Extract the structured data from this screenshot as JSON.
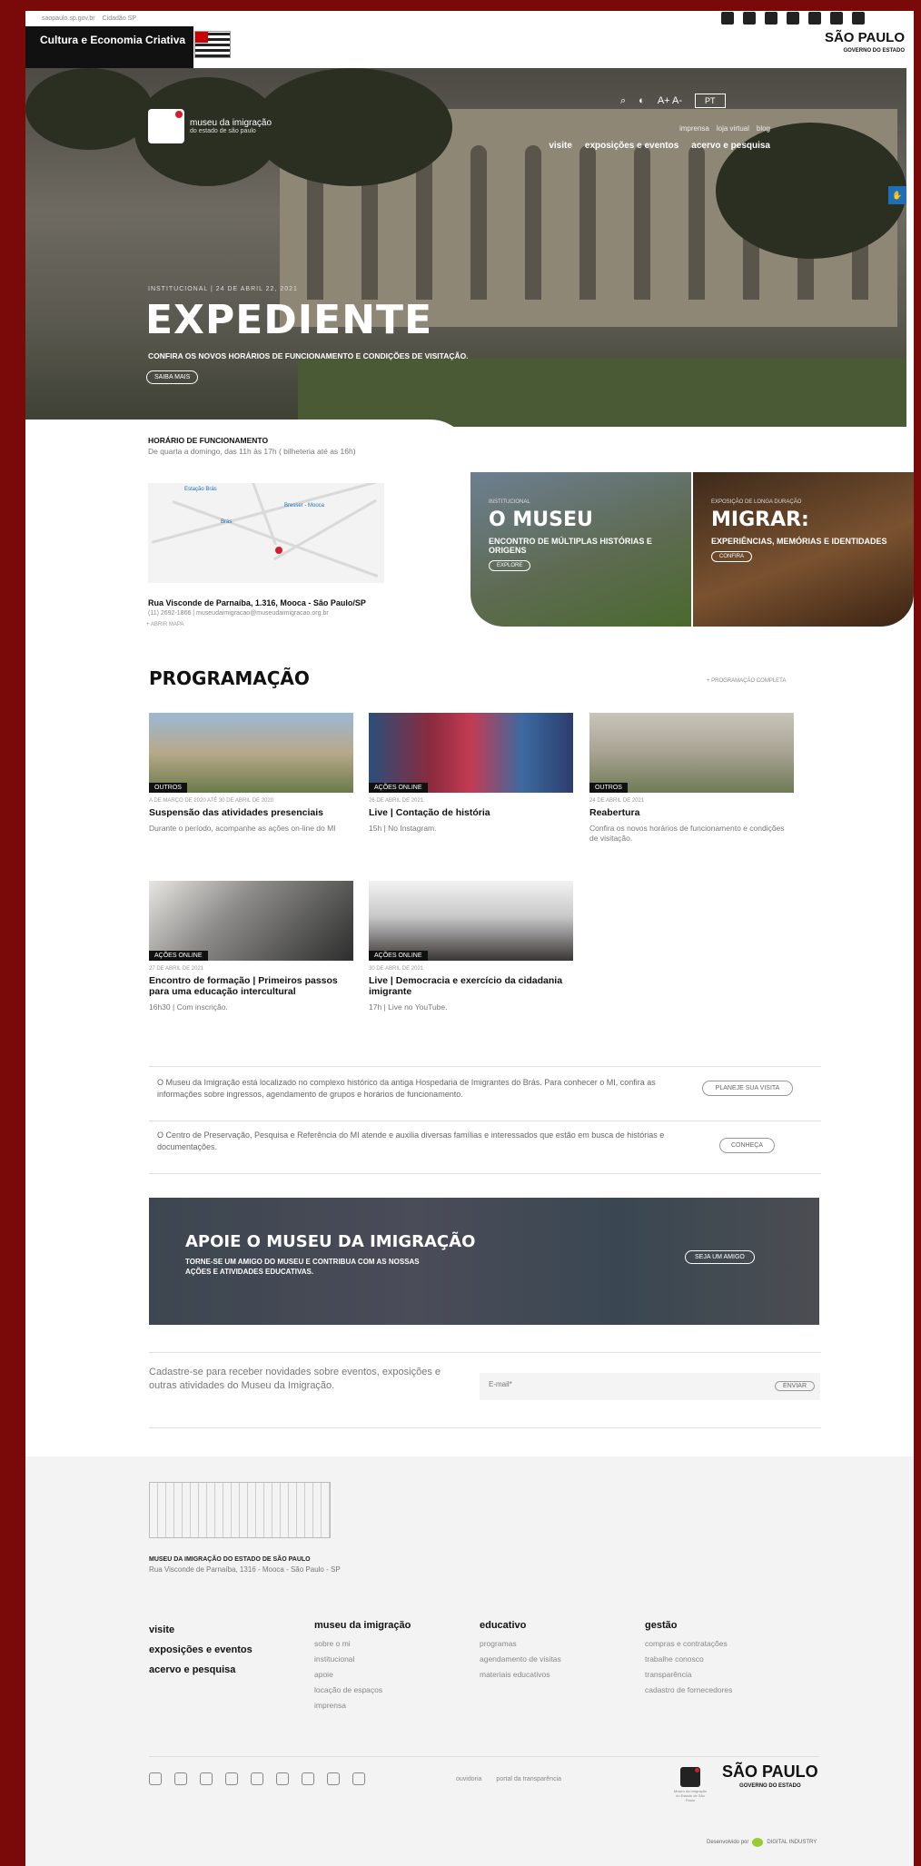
{
  "topbar": {
    "links": [
      "saopaulo.sp.gov.br",
      "Cidadão SP"
    ]
  },
  "gov": {
    "culture": "Cultura e Economia Criativa",
    "sp_title": "SÃO PAULO",
    "sp_sub": "GOVERNO DO ESTADO"
  },
  "brand": {
    "name": "museu da imigração",
    "sub": "do estado de são paulo"
  },
  "tools": {
    "search": "⌕",
    "contrast": "◐",
    "font": "A+ A-",
    "lang": "PT"
  },
  "nav": {
    "sub": [
      "imprensa",
      "loja virtual",
      "blog"
    ],
    "main": [
      "visite",
      "exposições e eventos",
      "acervo e pesquisa"
    ]
  },
  "slide": {
    "tag": "INSTITUCIONAL | 24 DE ABRIL 22, 2021",
    "title": "EXPEDIENTE",
    "desc": "CONFIRA OS NOVOS HORÁRIOS DE FUNCIONAMENTO E CONDIÇÕES DE VISITAÇÃO.",
    "button": "SAIBA MAIS"
  },
  "hours": {
    "title": "HORÁRIO DE FUNCIONAMENTO",
    "text": "De quarta a domingo, das 11h às 17h ( bilheteria até as 16h)"
  },
  "map": {
    "labels": [
      "Estação Brás",
      "Bresser - Mooca",
      "Brás"
    ]
  },
  "address": {
    "line": "Rua Visconde de Parnaíba, 1.316, Mooca - São Paulo/SP",
    "contact": "(11) 2692-1866 | museudaimigracao@museudaimigracao.org.br",
    "maplink": "+ ABRIR MAPA"
  },
  "cards": [
    {
      "tag": "INSTITUCIONAL",
      "title": "O MUSEU",
      "desc": "ENCONTRO DE MÚLTIPLAS HISTÓRIAS E ORIGENS",
      "button": "EXPLORE"
    },
    {
      "tag": "EXPOSIÇÃO DE LONGA DURAÇÃO",
      "title": "MIGRAR:",
      "desc": "EXPERIÊNCIAS, MEMÓRIAS E IDENTIDADES",
      "button": "CONFIRA"
    }
  ],
  "programacao": {
    "title": "PROGRAMAÇÃO",
    "link": "+ PROGRAMAÇÃO COMPLETA"
  },
  "events": [
    {
      "badge": "OUTROS",
      "date": "A DE MARÇO DE 2020 ATÉ 30 DE ABRIL DE 2020",
      "title": "Suspensão das atividades presenciais",
      "desc": "Durante o período, acompanhe as ações on-line do MI"
    },
    {
      "badge": "AÇÕES ONLINE",
      "date": "26 DE ABRIL DE 2021",
      "title": "Live | Contação de história",
      "desc": "15h | No Instagram."
    },
    {
      "badge": "OUTROS",
      "date": "24 DE ABRIL DE 2021",
      "title": "Reabertura",
      "desc": "Confira os novos horários de funcionamento e condições de visitação."
    },
    {
      "badge": "AÇÕES ONLINE",
      "date": "27 DE ABRIL DE 2021",
      "title": "Encontro de formação | Primeiros passos para uma educação intercultural",
      "desc": "16h30 | Com inscrição."
    },
    {
      "badge": "AÇÕES ONLINE",
      "date": "30 DE ABRIL DE 2021",
      "title": "Live | Democracia e exercício da cidadania imigrante",
      "desc": "17h | Live no YouTube."
    }
  ],
  "notes": [
    {
      "text": "O Museu da Imigração está localizado no complexo histórico da antiga Hospedaria de Imigrantes do Brás. Para conhecer o MI, confira as informações sobre ingressos, agendamento de grupos e horários de funcionamento.",
      "button": "PLANEJE SUA VISITA"
    },
    {
      "text": "O Centro de Preservação, Pesquisa e Referência do MI atende e auxilia diversas famílias e interessados que estão em busca de histórias e documentações.",
      "button": "CONHEÇA"
    }
  ],
  "apoie": {
    "title": "APOIE O MUSEU DA IMIGRAÇÃO",
    "text": "TORNE-SE UM AMIGO DO MUSEU E CONTRIBUA COM AS NOSSAS AÇÕES E ATIVIDADES EDUCATIVAS.",
    "button": "SEJA UM AMIGO"
  },
  "newsletter": {
    "text": "Cadastre-se para receber novidades sobre eventos, exposições e outras atividades do Museu da Imigração.",
    "placeholder": "E-mail*",
    "button": "ENVIAR"
  },
  "footer": {
    "name": "MUSEU DA IMIGRAÇÃO DO ESTADO DE SÃO PAULO",
    "address": "Rua Visconde de Parnaíba, 1316 - Mooca - São Paulo - SP",
    "col1": [
      "visite",
      "exposições e eventos",
      "acervo e pesquisa"
    ],
    "col2": {
      "head": "museu da imigração",
      "items": [
        "sobre o mi",
        "institucional",
        "apoie",
        "locação de espaços",
        "imprensa"
      ]
    },
    "col3": {
      "head": "educativo",
      "items": [
        "programas",
        "agendamento de visitas",
        "materiais educativos"
      ]
    },
    "col4": {
      "head": "gestão",
      "items": [
        "compras e contratações",
        "trabalhe conosco",
        "transparência",
        "cadastro de fornecedores"
      ]
    },
    "links": [
      "ouvidoria",
      "portal da transparência"
    ],
    "mi_small": "Museu da Imigração do Estado de São Paulo",
    "sp": "SÃO PAULO",
    "sp_sub": "GOVERNO DO ESTADO",
    "dev": "Desenvolvido por",
    "dev_name": "DIGITAL INDUSTRY"
  },
  "colors": {
    "accent": "#d51d2c",
    "frame": "#7a0a0a",
    "blue": "#1c6fb8"
  }
}
